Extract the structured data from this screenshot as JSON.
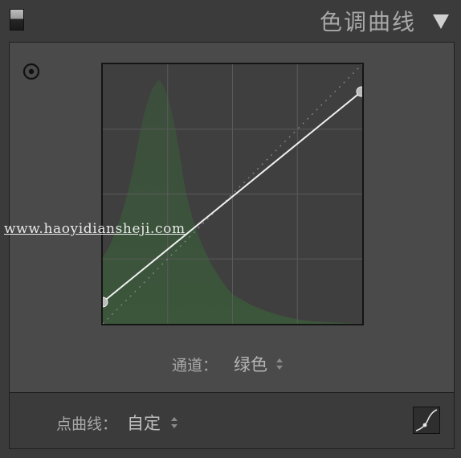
{
  "panel": {
    "title": "色调曲线"
  },
  "curve": {
    "channel_label": "通道：",
    "channel_value": "绿色",
    "point_curve_label": "点曲线：",
    "point_curve_value": "自定",
    "histogram_color": "#3a5a3a"
  },
  "watermark": {
    "text": "www.haoyidiansheji.com"
  },
  "icons": {
    "panel_toggle": "panel-toggle-icon",
    "collapse": "triangle-down-icon",
    "target_adjust": "target-icon",
    "stepper": "up-down-arrows-icon",
    "edit_point_curve": "curve-edit-icon"
  }
}
